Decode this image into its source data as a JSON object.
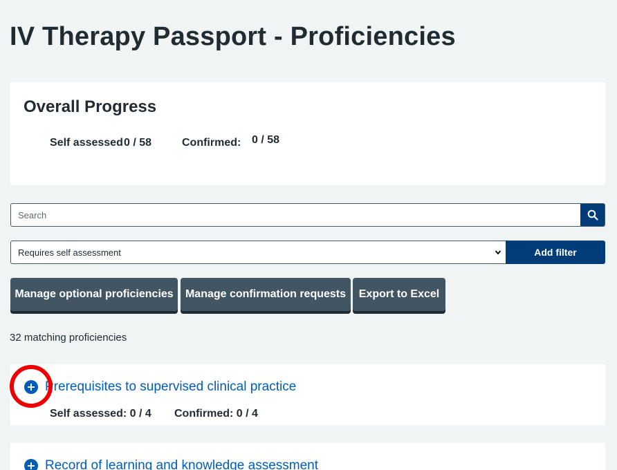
{
  "page": {
    "title": "IV Therapy Passport - Proficiencies"
  },
  "overall_progress": {
    "title": "Overall Progress",
    "self_assessed_label": "Self assessed",
    "self_assessed_value": "0 / 58",
    "confirmed_label": "Confirmed:",
    "confirmed_value": "0 / 58"
  },
  "search": {
    "placeholder": "Search",
    "button_icon": "search-icon"
  },
  "filter": {
    "selected": "Requires self assessment",
    "add_label": "Add filter"
  },
  "actions": {
    "manage_optional": "Manage optional proficiencies",
    "manage_confirmation": "Manage confirmation requests",
    "export": "Export to Excel"
  },
  "results": {
    "count_text": "32 matching proficiencies"
  },
  "sections": [
    {
      "title": "Prerequisites to supervised clinical practice",
      "stats": "Self assessed: 0 / 4     Confirmed: 0 / 4",
      "self_assessed": "Self assessed: 0 / 4",
      "confirmed": "Confirmed: 0 / 4",
      "icon": "plus-circle-icon"
    },
    {
      "title": "Record of learning and knowledge assessment",
      "icon": "plus-circle-icon"
    }
  ],
  "colors": {
    "background": "#f0f4f5",
    "primary": "#005eb8",
    "dark_blue": "#003d78",
    "secondary_button": "#425563",
    "highlight": "#ee0000"
  }
}
